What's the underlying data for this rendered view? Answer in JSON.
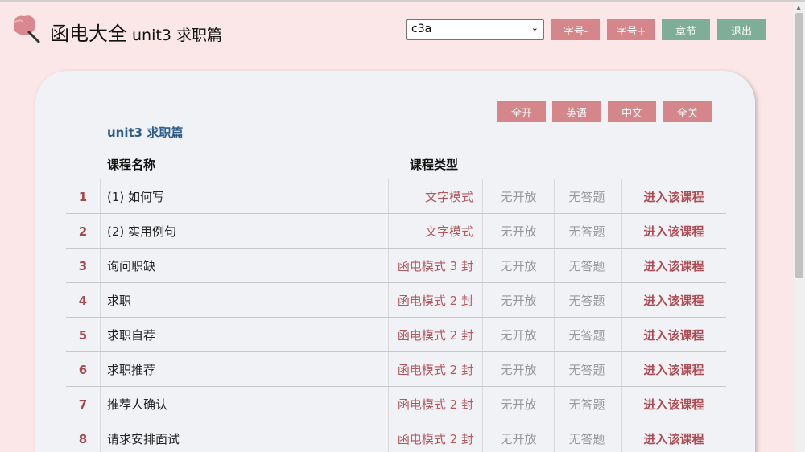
{
  "header": {
    "title": "函电大全",
    "subtitle": "unit3 求职篇",
    "select_value": "c3a",
    "font_minus": "字号-",
    "font_plus": "字号+",
    "chapters": "章节",
    "logout": "退出"
  },
  "filters": {
    "all_open": "全开",
    "english": "英语",
    "chinese": "中文",
    "all_close": "全关"
  },
  "unit_title": "unit3 求职篇",
  "columns": {
    "name": "课程名称",
    "type": "课程类型"
  },
  "rows": [
    {
      "num": "1",
      "name": "(1) 如何写",
      "type": "文字模式",
      "open": "无开放",
      "answer": "无答题",
      "enter": "进入该课程"
    },
    {
      "num": "2",
      "name": "(2) 实用例句",
      "type": "文字模式",
      "open": "无开放",
      "answer": "无答题",
      "enter": "进入该课程"
    },
    {
      "num": "3",
      "name": "询问职缺",
      "type": "函电模式 3 封",
      "open": "无开放",
      "answer": "无答题",
      "enter": "进入该课程"
    },
    {
      "num": "4",
      "name": "求职",
      "type": "函电模式 2 封",
      "open": "无开放",
      "answer": "无答题",
      "enter": "进入该课程"
    },
    {
      "num": "5",
      "name": "求职自荐",
      "type": "函电模式 2 封",
      "open": "无开放",
      "answer": "无答题",
      "enter": "进入该课程"
    },
    {
      "num": "6",
      "name": "求职推荐",
      "type": "函电模式 2 封",
      "open": "无开放",
      "answer": "无答题",
      "enter": "进入该课程"
    },
    {
      "num": "7",
      "name": "推荐人确认",
      "type": "函电模式 2 封",
      "open": "无开放",
      "answer": "无答题",
      "enter": "进入该课程"
    },
    {
      "num": "8",
      "name": "请求安排面试",
      "type": "函电模式 2 封",
      "open": "无开放",
      "answer": "无答题",
      "enter": "进入该课程"
    }
  ],
  "colors": {
    "page_bg": "#fbe7e7",
    "card_bg": "#f1f2f6",
    "pink_button": "#d4868b",
    "green_button": "#7fae96",
    "unit_title": "#2c5c8a",
    "accent": "#b04a52"
  },
  "icons": {
    "logo": "pink-pushpin-logo-icon",
    "select_arrow": "chevron-down-icon"
  }
}
